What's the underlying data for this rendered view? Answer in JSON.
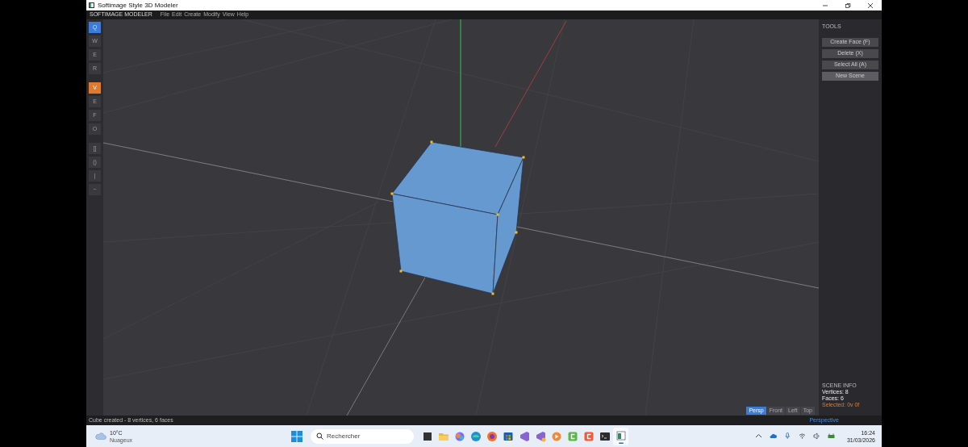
{
  "window": {
    "title": "Softimage Style 3D Modeler"
  },
  "menu_bar": {
    "brand": "SOFTIMAGE MODELER",
    "items": [
      "File",
      "Edit",
      "Create",
      "Modify",
      "View",
      "Help"
    ]
  },
  "toolbar": {
    "groups": [
      [
        {
          "label": "Q",
          "selected": true
        },
        {
          "label": "W",
          "selected": false
        },
        {
          "label": "E",
          "selected": false
        },
        {
          "label": "R",
          "selected": false
        }
      ],
      [
        {
          "label": "V",
          "selected": true
        },
        {
          "label": "E",
          "selected": false
        },
        {
          "label": "F",
          "selected": false
        },
        {
          "label": "O",
          "selected": false
        }
      ],
      [
        {
          "label": "[]",
          "selected": false
        },
        {
          "label": "()",
          "selected": false
        },
        {
          "label": "|",
          "selected": false
        },
        {
          "label": "~",
          "selected": false
        }
      ]
    ]
  },
  "tools_panel": {
    "title": "TOOLS",
    "buttons": [
      {
        "label": "Create Face (F)",
        "hovered": false
      },
      {
        "label": "Delete (X)",
        "hovered": false
      },
      {
        "label": "Select All (A)",
        "hovered": false
      },
      {
        "label": "New Scene",
        "hovered": true
      }
    ]
  },
  "scene_info": {
    "title": "SCENE INFO",
    "vertices": "Vertices: 8",
    "faces": "Faces: 6",
    "selected": "Selected: 0v 0f"
  },
  "view_buttons": [
    {
      "label": "Persp",
      "selected": true
    },
    {
      "label": "Front",
      "selected": false
    },
    {
      "label": "Left",
      "selected": false
    },
    {
      "label": "Top",
      "selected": false
    }
  ],
  "status_bar": {
    "message": "Cube created - 8 vertices, 6 faces",
    "view": "Perspective"
  },
  "taskbar": {
    "temperature": "10°C",
    "weather": "Nuageux",
    "search_placeholder": "Rechercher",
    "apps": [
      {
        "kind": "terminal-dark",
        "active": false
      },
      {
        "kind": "folder",
        "active": false
      },
      {
        "kind": "copilot",
        "active": false
      },
      {
        "kind": "edge",
        "active": false
      },
      {
        "kind": "firefox",
        "active": false
      },
      {
        "kind": "store",
        "active": false
      },
      {
        "kind": "vs",
        "active": false
      },
      {
        "kind": "vs-preview",
        "active": false
      },
      {
        "kind": "media",
        "active": false
      },
      {
        "kind": "green-c",
        "active": false
      },
      {
        "kind": "orange-c",
        "active": false
      },
      {
        "kind": "terminal",
        "active": false
      },
      {
        "kind": "window",
        "active": true
      }
    ],
    "time": "16:24",
    "date": "31/03/2026"
  }
}
